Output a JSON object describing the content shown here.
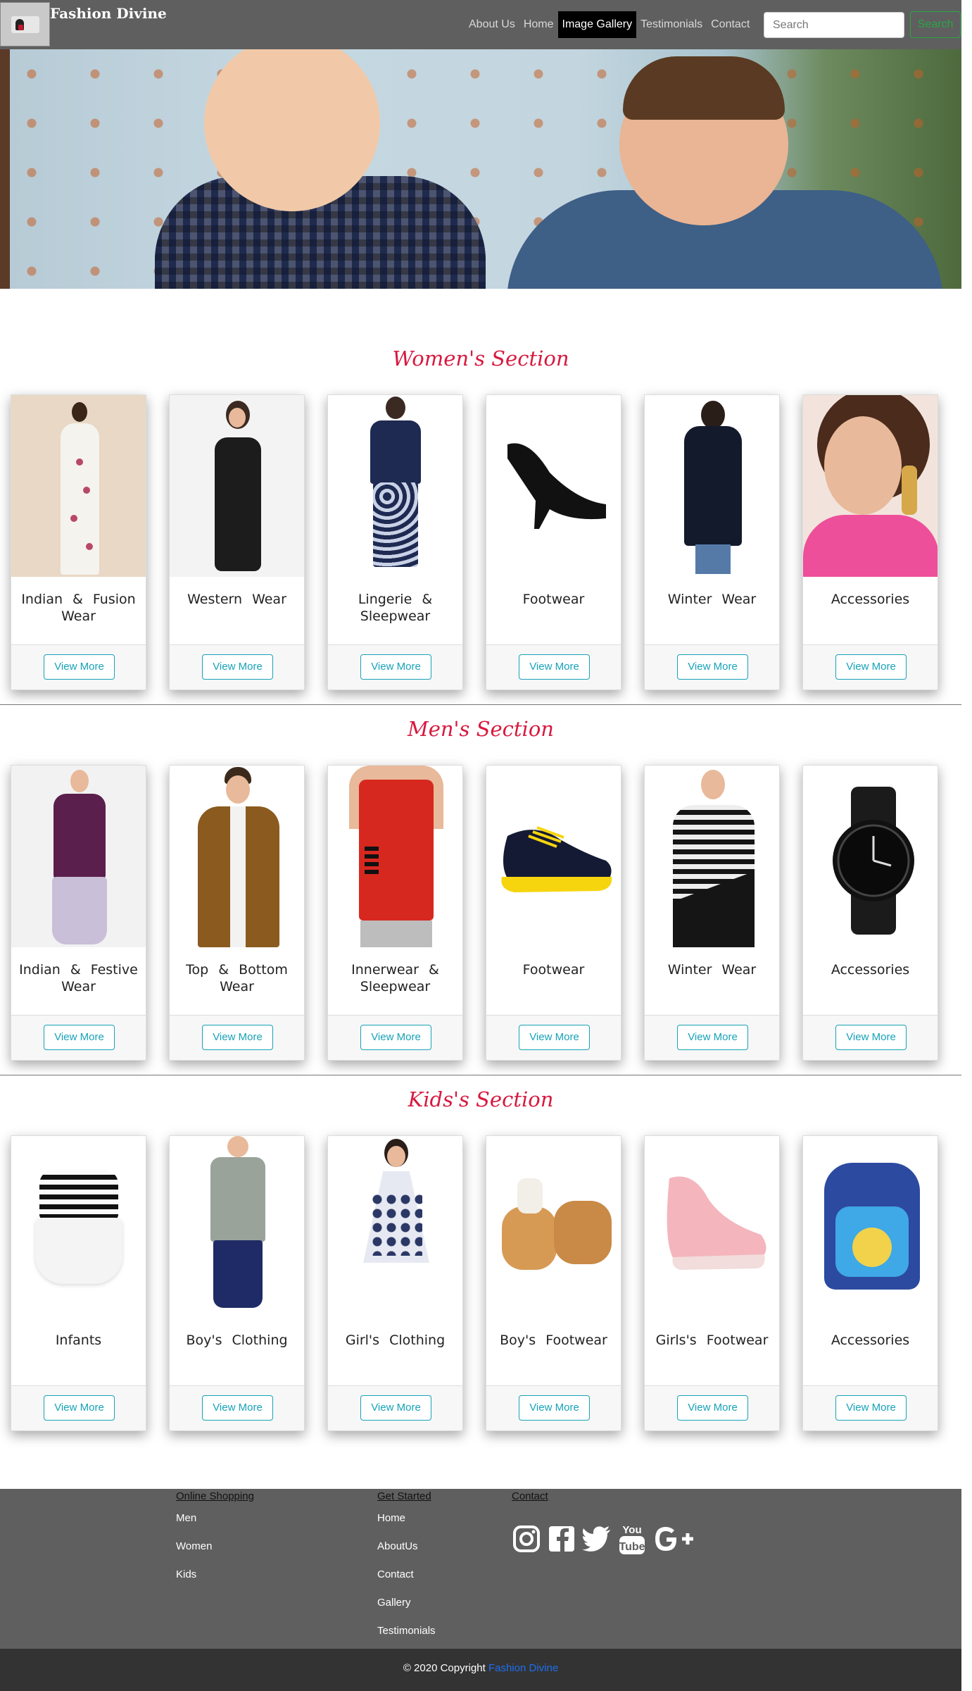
{
  "nav": {
    "brand": "Fashion Divine",
    "links": [
      "About Us",
      "Home",
      "Image Gallery",
      "Testimonials",
      "Contact"
    ],
    "active": "Image Gallery",
    "search_placeholder": "Search",
    "search_button": "Search"
  },
  "sections": [
    {
      "title": "Women's Section",
      "cards": [
        {
          "label": "Indian & Fusion Wear",
          "button": "View More"
        },
        {
          "label": "Western Wear",
          "button": "View More"
        },
        {
          "label": "Lingerie & Sleepwear",
          "button": "View More"
        },
        {
          "label": "Footwear",
          "button": "View More"
        },
        {
          "label": "Winter Wear",
          "button": "View More"
        },
        {
          "label": "Accessories",
          "button": "View More"
        }
      ]
    },
    {
      "title": "Men's Section",
      "cards": [
        {
          "label": "Indian & Festive Wear",
          "button": "View More"
        },
        {
          "label": "Top & Bottom Wear",
          "button": "View More"
        },
        {
          "label": "Innerwear & Sleepwear",
          "button": "View More"
        },
        {
          "label": "Footwear",
          "button": "View More"
        },
        {
          "label": "Winter Wear",
          "button": "View More"
        },
        {
          "label": "Accessories",
          "button": "View More"
        }
      ]
    },
    {
      "title": "Kids's Section",
      "cards": [
        {
          "label": "Infants",
          "button": "View More"
        },
        {
          "label": "Boy's Clothing",
          "button": "View More"
        },
        {
          "label": "Girl's Clothing",
          "button": "View More"
        },
        {
          "label": "Boy's Footwear",
          "button": "View More"
        },
        {
          "label": "Girls's Footwear",
          "button": "View More"
        },
        {
          "label": "Accessories",
          "button": "View More"
        }
      ]
    }
  ],
  "footer": {
    "online_shopping": {
      "heading": "Online Shopping",
      "items": [
        "Men",
        "Women",
        "Kids"
      ]
    },
    "get_started": {
      "heading": "Get Started",
      "items": [
        "Home",
        "AboutUs",
        "Contact",
        "Gallery",
        "Testimonials"
      ]
    },
    "contact": {
      "heading": "Contact",
      "social": [
        "instagram-icon",
        "facebook-icon",
        "twitter-icon",
        "youtube-icon",
        "google-plus-icon"
      ]
    },
    "copyright_prefix": "© 2020 Copyright",
    "copyright_brand": "Fashion Divine"
  },
  "colors": {
    "nav_bg": "#5f5f5f",
    "section_title": "#d7193f",
    "button": "#17a2b8",
    "search_button": "#28a745",
    "footer_bottom": "#333333",
    "link_blue": "#1e6ff0"
  }
}
